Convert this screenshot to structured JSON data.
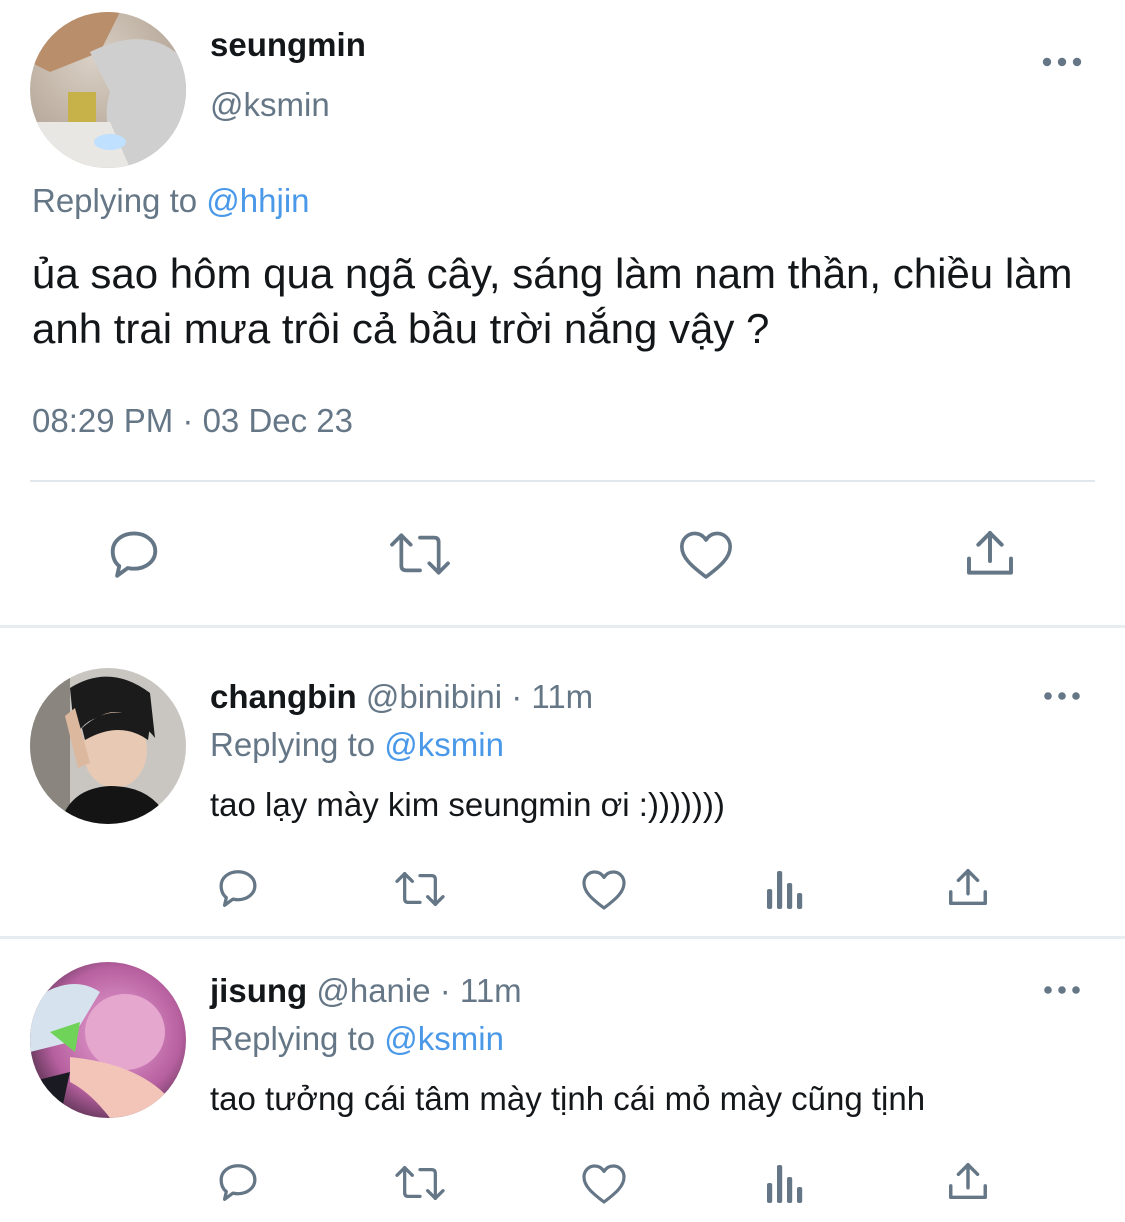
{
  "main_tweet": {
    "display_name": "seungmin",
    "handle": "@ksmin",
    "replying_label": "Replying to",
    "replying_to": "@hhjin",
    "text": "ủa sao hôm qua ngã cây, sáng làm nam thần, chiều làm anh trai mưa trôi cả bầu trời nắng vậy ?",
    "timestamp": "08:29 PM · 03 Dec 23",
    "actions": [
      "reply-icon",
      "retweet-icon",
      "like-icon",
      "share-icon"
    ]
  },
  "replies": [
    {
      "display_name": "changbin",
      "handle": "@binibini",
      "time": "· 11m",
      "replying_label": "Replying to",
      "replying_to": "@ksmin",
      "text": "tao lạy mày kim seungmin ơi :)))))))",
      "actions": [
        "reply-icon",
        "retweet-icon",
        "like-icon",
        "analytics-icon",
        "share-icon"
      ]
    },
    {
      "display_name": "jisung",
      "handle": "@hanie",
      "time": "· 11m",
      "replying_label": "Replying to",
      "replying_to": "@ksmin",
      "text": "tao tưởng cái tâm mày tịnh cái mỏ mày cũng tịnh",
      "actions": [
        "reply-icon",
        "retweet-icon",
        "like-icon",
        "analytics-icon",
        "share-icon"
      ]
    }
  ],
  "colors": {
    "text": "#14171a",
    "secondary": "#657786",
    "link": "#4a99e9",
    "icon": "#657786",
    "divider": "#e1e8ed"
  }
}
